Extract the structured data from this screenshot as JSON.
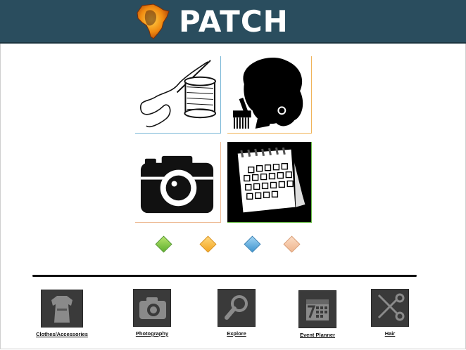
{
  "header": {
    "title": "PATCH",
    "background": "#2a4d5e"
  },
  "tiles": [
    {
      "icon": "needle-thread-icon"
    },
    {
      "icon": "afro-silhouette-icon"
    },
    {
      "icon": "camera-icon"
    },
    {
      "icon": "calendar-icon"
    }
  ],
  "slider": {
    "dots": [
      "#6cc04a",
      "#f3a51f",
      "#3f95cf",
      "#efb58e"
    ]
  },
  "nav": {
    "items": [
      {
        "label": "Clothes/Accessories",
        "icon": "dress-icon"
      },
      {
        "label": "Photography",
        "icon": "camera-icon"
      },
      {
        "label": "Explore",
        "icon": "magnifier-icon"
      },
      {
        "label": "Event Planner",
        "icon": "calendar-icon"
      },
      {
        "label": "Hair",
        "icon": "scissors-icon"
      }
    ]
  }
}
